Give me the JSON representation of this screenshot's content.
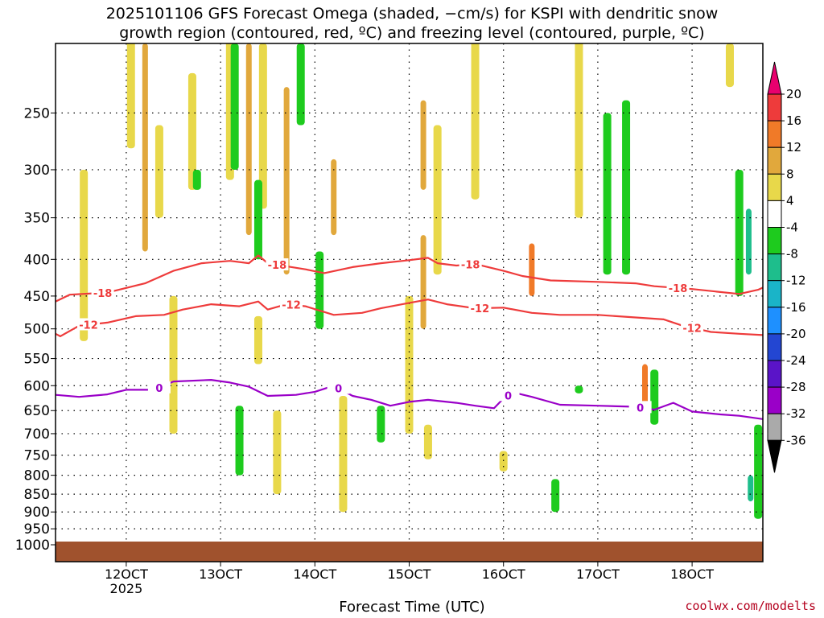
{
  "title_line1": "2025101106 GFS Forecast Omega (shaded, −cm/s) for KSPI with dendritic snow",
  "title_line2": "growth region (contoured, red, ºC) and freezing level (contoured, purple, ºC)",
  "credit": "coolwx.com/modelts",
  "colors": {
    "red_contour": "#ee3b3b",
    "purple_contour": "#9a00c8",
    "ground": "#a0522d",
    "grid": "#000000"
  },
  "chart_data": {
    "type": "heatmap",
    "xlabel": "Forecast Time (UTC)",
    "ylabel": "",
    "x_ticks": [
      {
        "value": 120,
        "label": "12OCT",
        "sublabel": "2025"
      },
      {
        "value": 130,
        "label": "13OCT",
        "sublabel": ""
      },
      {
        "value": 140,
        "label": "14OCT",
        "sublabel": ""
      },
      {
        "value": 150,
        "label": "15OCT",
        "sublabel": ""
      },
      {
        "value": 160,
        "label": "16OCT",
        "sublabel": ""
      },
      {
        "value": 170,
        "label": "17OCT",
        "sublabel": ""
      },
      {
        "value": 180,
        "label": "18OCT",
        "sublabel": ""
      }
    ],
    "xlim": [
      112.5,
      187.5
    ],
    "y_scale": "log",
    "y_ticks": [
      250,
      300,
      350,
      400,
      450,
      500,
      550,
      600,
      650,
      700,
      750,
      800,
      850,
      900,
      950,
      1000
    ],
    "ylim": [
      1000,
      200
    ],
    "colorbar": {
      "labels": [
        "20",
        "16",
        "12",
        "8",
        "4",
        "-4",
        "-8",
        "-12",
        "-16",
        "-20",
        "-24",
        "-28",
        "-32",
        "-36"
      ],
      "colors": [
        "#e8006e",
        "#ee3b3b",
        "#f07a28",
        "#e1a83c",
        "#e8d84a",
        "#ffffff",
        "#1ecb1e",
        "#1ebe8c",
        "#1ab4c8",
        "#1e90ff",
        "#2346d2",
        "#5a14c8",
        "#9a00c8",
        "#aaaaaa",
        "#000000"
      ]
    },
    "contours": [
      {
        "label": "-18",
        "color": "#ee3b3b",
        "label_positions": [
          117.5,
          136,
          156.5,
          178.5
        ],
        "points": [
          [
            112.5,
            458
          ],
          [
            114,
            448
          ],
          [
            118,
            445
          ],
          [
            122,
            432
          ],
          [
            125,
            415
          ],
          [
            128,
            405
          ],
          [
            131,
            402
          ],
          [
            133,
            405
          ],
          [
            134,
            395
          ],
          [
            135,
            405
          ],
          [
            137,
            409
          ],
          [
            139,
            413
          ],
          [
            141,
            418
          ],
          [
            144,
            410
          ],
          [
            147,
            405
          ],
          [
            150,
            401
          ],
          [
            152,
            398
          ],
          [
            153,
            405
          ],
          [
            155,
            408
          ],
          [
            157,
            406
          ],
          [
            160,
            415
          ],
          [
            162,
            422
          ],
          [
            165,
            428
          ],
          [
            170,
            430
          ],
          [
            174,
            432
          ],
          [
            176,
            436
          ],
          [
            180,
            440
          ],
          [
            185,
            447
          ],
          [
            187,
            441
          ],
          [
            187.5,
            438
          ]
        ]
      },
      {
        "label": "-12",
        "color": "#ee3b3b",
        "label_positions": [
          116,
          137.5,
          157.5,
          180
        ],
        "points": [
          [
            112.5,
            508
          ],
          [
            113,
            512
          ],
          [
            115,
            495
          ],
          [
            118,
            490
          ],
          [
            121,
            480
          ],
          [
            124,
            478
          ],
          [
            126,
            470
          ],
          [
            129,
            462
          ],
          [
            132,
            465
          ],
          [
            134,
            458
          ],
          [
            135,
            470
          ],
          [
            137,
            462
          ],
          [
            139,
            465
          ],
          [
            142,
            478
          ],
          [
            145,
            475
          ],
          [
            147,
            468
          ],
          [
            150,
            460
          ],
          [
            152,
            455
          ],
          [
            154,
            462
          ],
          [
            157,
            468
          ],
          [
            160,
            467
          ],
          [
            163,
            475
          ],
          [
            166,
            478
          ],
          [
            170,
            478
          ],
          [
            174,
            482
          ],
          [
            177,
            485
          ],
          [
            179,
            495
          ],
          [
            182,
            505
          ],
          [
            185,
            508
          ],
          [
            187.5,
            510
          ]
        ]
      },
      {
        "label": "0",
        "color": "#9a00c8",
        "label_positions": [
          123.5,
          142.5,
          160.5,
          174.5
        ],
        "points": [
          [
            112.5,
            618
          ],
          [
            115,
            622
          ],
          [
            118,
            617
          ],
          [
            120,
            608
          ],
          [
            123,
            608
          ],
          [
            125,
            592
          ],
          [
            129,
            589
          ],
          [
            131,
            594
          ],
          [
            133,
            602
          ],
          [
            135,
            620
          ],
          [
            138,
            618
          ],
          [
            140,
            612
          ],
          [
            142,
            600
          ],
          [
            144,
            620
          ],
          [
            146,
            628
          ],
          [
            148,
            640
          ],
          [
            150,
            632
          ],
          [
            152,
            628
          ],
          [
            155,
            634
          ],
          [
            157,
            640
          ],
          [
            159,
            645
          ],
          [
            160,
            625
          ],
          [
            161,
            613
          ],
          [
            163,
            622
          ],
          [
            166,
            638
          ],
          [
            170,
            640
          ],
          [
            174,
            642
          ],
          [
            176,
            648
          ],
          [
            178,
            634
          ],
          [
            180,
            652
          ],
          [
            183,
            658
          ],
          [
            185,
            661
          ],
          [
            187.5,
            668
          ]
        ]
      }
    ],
    "omega_regions": [
      {
        "x": 120.5,
        "p0": 150,
        "p1": 280,
        "value": 6
      },
      {
        "x": 122,
        "p0": 200,
        "p1": 390,
        "value": 10
      },
      {
        "x": 123.5,
        "p0": 260,
        "p1": 350,
        "value": 6
      },
      {
        "x": 127,
        "p0": 220,
        "p1": 320,
        "value": 6
      },
      {
        "x": 131,
        "p0": 150,
        "p1": 310,
        "value": 6
      },
      {
        "x": 133,
        "p0": 200,
        "p1": 370,
        "value": 10
      },
      {
        "x": 134.5,
        "p0": 200,
        "p1": 340,
        "value": 6
      },
      {
        "x": 137,
        "p0": 230,
        "p1": 420,
        "value": 10
      },
      {
        "x": 142,
        "p0": 290,
        "p1": 370,
        "value": 10
      },
      {
        "x": 151.5,
        "p0": 240,
        "p1": 320,
        "value": 10
      },
      {
        "x": 151.5,
        "p0": 370,
        "p1": 500,
        "value": 10
      },
      {
        "x": 153,
        "p0": 260,
        "p1": 420,
        "value": 6
      },
      {
        "x": 157,
        "p0": 190,
        "p1": 330,
        "value": 6
      },
      {
        "x": 163,
        "p0": 380,
        "p1": 450,
        "value": 12
      },
      {
        "x": 168,
        "p0": 150,
        "p1": 350,
        "value": 6
      },
      {
        "x": 175,
        "p0": 560,
        "p1": 640,
        "value": 12
      },
      {
        "x": 115.5,
        "p0": 300,
        "p1": 520,
        "value": 6
      },
      {
        "x": 125,
        "p0": 450,
        "p1": 700,
        "value": 6
      },
      {
        "x": 143,
        "p0": 620,
        "p1": 900,
        "value": 6
      },
      {
        "x": 150,
        "p0": 450,
        "p1": 700,
        "value": 6
      },
      {
        "x": 152,
        "p0": 680,
        "p1": 760,
        "value": 6
      },
      {
        "x": 136,
        "p0": 650,
        "p1": 850,
        "value": 6
      },
      {
        "x": 134,
        "p0": 480,
        "p1": 560,
        "value": 6
      },
      {
        "x": 160,
        "p0": 740,
        "p1": 790,
        "value": 6
      },
      {
        "x": 184,
        "p0": 200,
        "p1": 230,
        "value": 6
      },
      {
        "x": 127.5,
        "p0": 300,
        "p1": 320,
        "value": -6
      },
      {
        "x": 131.5,
        "p0": 200,
        "p1": 300,
        "value": -6
      },
      {
        "x": 134,
        "p0": 310,
        "p1": 400,
        "value": -6
      },
      {
        "x": 138.5,
        "p0": 200,
        "p1": 260,
        "value": -6
      },
      {
        "x": 132,
        "p0": 640,
        "p1": 800,
        "value": -6
      },
      {
        "x": 140.5,
        "p0": 390,
        "p1": 500,
        "value": -6
      },
      {
        "x": 147,
        "p0": 640,
        "p1": 720,
        "value": -6
      },
      {
        "x": 165.5,
        "p0": 810,
        "p1": 900,
        "value": -6
      },
      {
        "x": 168,
        "p0": 600,
        "p1": 615,
        "value": -6
      },
      {
        "x": 171,
        "p0": 250,
        "p1": 420,
        "value": -6
      },
      {
        "x": 173,
        "p0": 240,
        "p1": 420,
        "value": -6
      },
      {
        "x": 176,
        "p0": 570,
        "p1": 680,
        "value": -6
      },
      {
        "x": 185,
        "p0": 300,
        "p1": 450,
        "value": -6
      },
      {
        "x": 186,
        "p0": 340,
        "p1": 420,
        "value": -10
      },
      {
        "x": 187,
        "p0": 680,
        "p1": 920,
        "value": -6
      },
      {
        "x": 186.2,
        "p0": 800,
        "p1": 870,
        "value": -10
      }
    ]
  }
}
